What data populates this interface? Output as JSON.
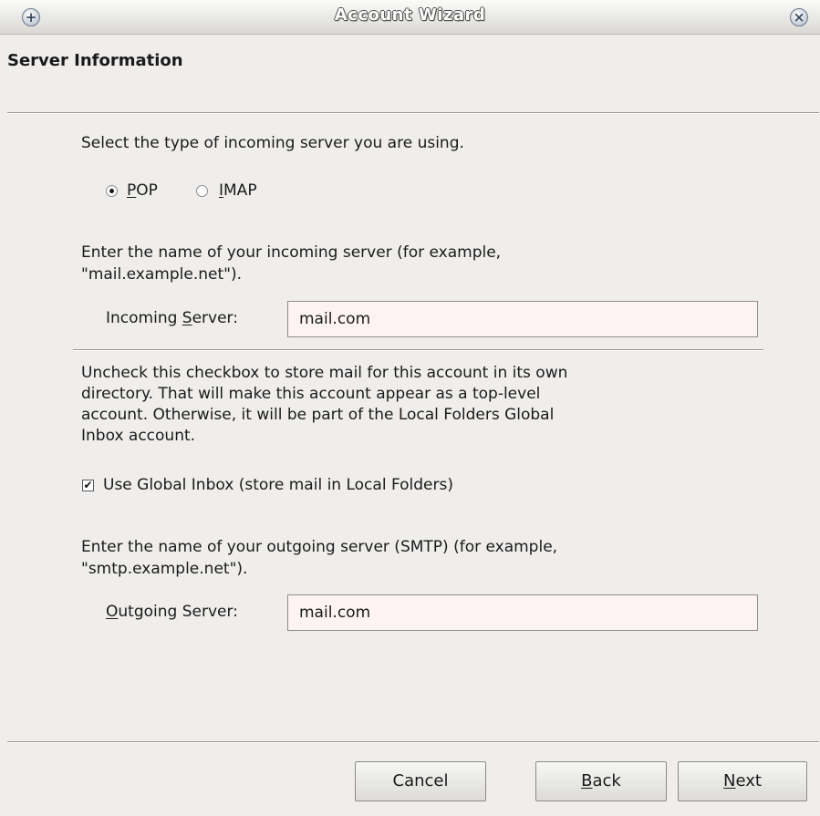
{
  "window": {
    "title": "Account Wizard"
  },
  "page": {
    "heading": "Server Information"
  },
  "incoming_type": {
    "prompt": "Select the type of incoming server you are using.",
    "options": [
      {
        "label": "POP",
        "mnemonic": "P",
        "selected": true
      },
      {
        "label": "IMAP",
        "mnemonic": "I",
        "selected": false
      }
    ]
  },
  "incoming": {
    "prompt_line1": "Enter the name of your incoming server (for example,",
    "prompt_line2": "\"mail.example.net\").",
    "label_pre": "Incoming ",
    "label_mnemonic": "S",
    "label_post": "erver:",
    "value": "mail.com"
  },
  "global_inbox": {
    "description": "Uncheck this checkbox to store mail for this account in its own\ndirectory. That will make this account appear as a top-level\naccount. Otherwise, it will be part of the Local Folders Global\nInbox account.",
    "checkbox_label": "Use Global Inbox (store mail in Local Folders)",
    "checked": true
  },
  "outgoing": {
    "prompt_line1": "Enter the name of your outgoing server (SMTP) (for example,",
    "prompt_line2": "\"smtp.example.net\").",
    "label_mnemonic": "O",
    "label_post": "utgoing Server:",
    "value": "mail.com"
  },
  "buttons": {
    "cancel": "Cancel",
    "back_mnemonic": "B",
    "back_rest": "ack",
    "next_mnemonic": "N",
    "next_rest": "ext"
  },
  "icons": {
    "title_left": "add-icon",
    "title_right": "close-icon"
  }
}
